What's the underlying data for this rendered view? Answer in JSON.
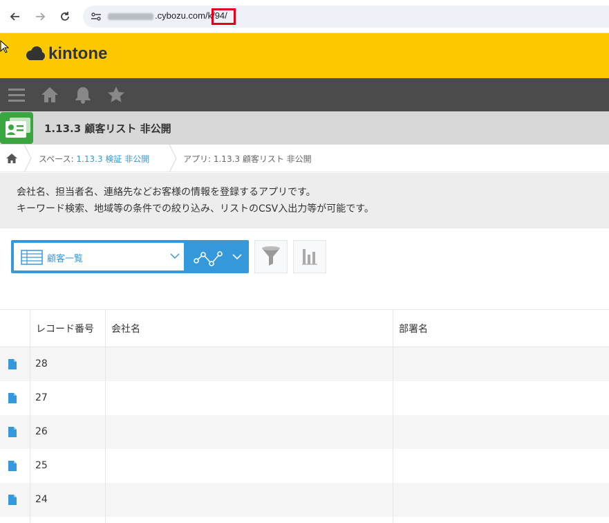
{
  "browser": {
    "url_text": ".cybozu.com/k/94/"
  },
  "header": {
    "logo_text": "kintone"
  },
  "app": {
    "title": "1.13.3 顧客リスト 非公開"
  },
  "breadcrumb": {
    "space_prefix": "スペース: ",
    "space_name": "1.13.3 検証 非公開",
    "app_text": "アプリ: 1.13.3 顧客リスト 非公開"
  },
  "description": {
    "line1": "会社名、担当者名、連絡先などお客様の情報を登録するアプリです。",
    "line2": "キーワード検索、地域等の条件での絞り込み、リストのCSV入出力等が可能です。"
  },
  "view": {
    "selected": "顧客一覧"
  },
  "table": {
    "headers": [
      "レコード番号",
      "会社名",
      "部署名"
    ],
    "rows": [
      {
        "record_no": "28"
      },
      {
        "record_no": "27"
      },
      {
        "record_no": "26"
      },
      {
        "record_no": "25"
      },
      {
        "record_no": "24"
      }
    ]
  },
  "colors": {
    "header_yellow": "#fcc800",
    "gnav_dark": "#4b4b4b",
    "accent_blue": "#3498db"
  }
}
